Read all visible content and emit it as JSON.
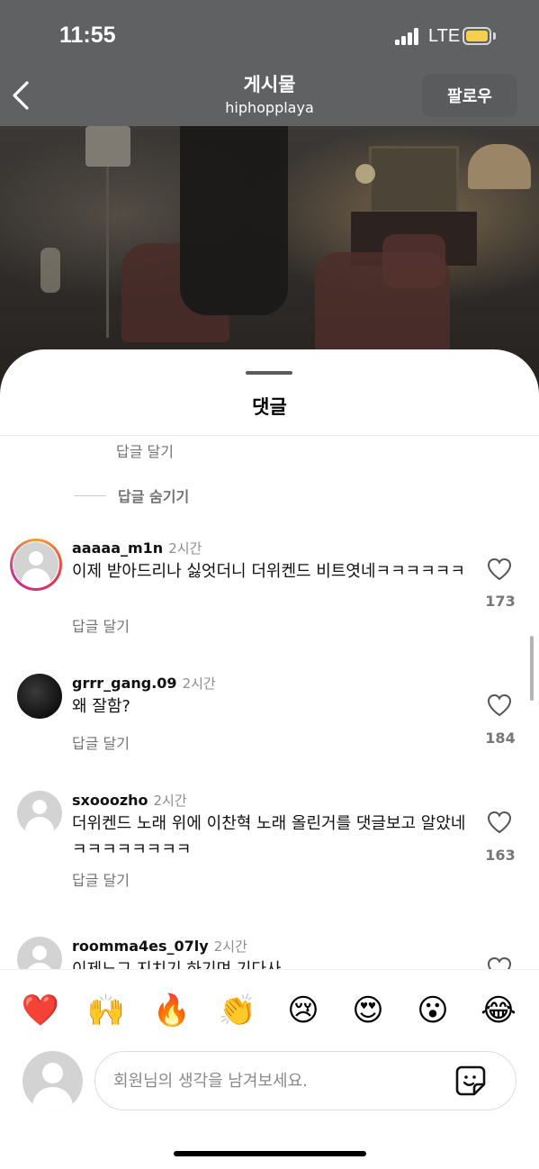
{
  "status_bar": {
    "time": "11:55",
    "network": "LTE"
  },
  "header": {
    "title": "게시물",
    "username": "hiphopplaya",
    "follow_label": "팔로우"
  },
  "sheet": {
    "title": "댓글",
    "top_reply_label": "답글 달기",
    "hide_replies_label": "답글 숨기기"
  },
  "comments": [
    {
      "username": "aaaaa_m1n",
      "time": "2시간",
      "text": "이제 받아드리나 싫엇더니 더위켄드 비트엿네ㅋㅋㅋㅋㅋㅋ",
      "reply_label": "답글 달기",
      "likes": "173",
      "has_story": true
    },
    {
      "username": "grrr_gang.09",
      "time": "2시간",
      "text": "왜 잘함?",
      "reply_label": "답글 달기",
      "likes": "184"
    },
    {
      "username": "sxooozho",
      "time": "2시간",
      "text": "더위켄드 노래 위에 이찬혁 노래 올린거를 댓글보고 알았네ㅋㅋㅋㅋㅋㅋㅋㅋ",
      "reply_label": "답글 달기",
      "likes": "163"
    },
    {
      "username": "roomma4es_07ly",
      "time": "2시간",
      "text": "이제느그 지치기 하기며 기다사",
      "reply_label": "",
      "likes": ""
    }
  ],
  "emoji_bar": [
    "❤️",
    "🙌",
    "🔥",
    "👏",
    "😢",
    "😍",
    "😮",
    "😂"
  ],
  "composer": {
    "placeholder": "회원님의 생각을 남겨보세요.",
    "value": ""
  },
  "colors": {
    "dim_overlay": "#5f6163",
    "battery": "#f4d04d",
    "meta_gray": "#737373"
  },
  "icons": [
    "back-icon",
    "heart-icon",
    "sticker-icon",
    "signal-icon",
    "battery-icon",
    "default-avatar-icon"
  ]
}
